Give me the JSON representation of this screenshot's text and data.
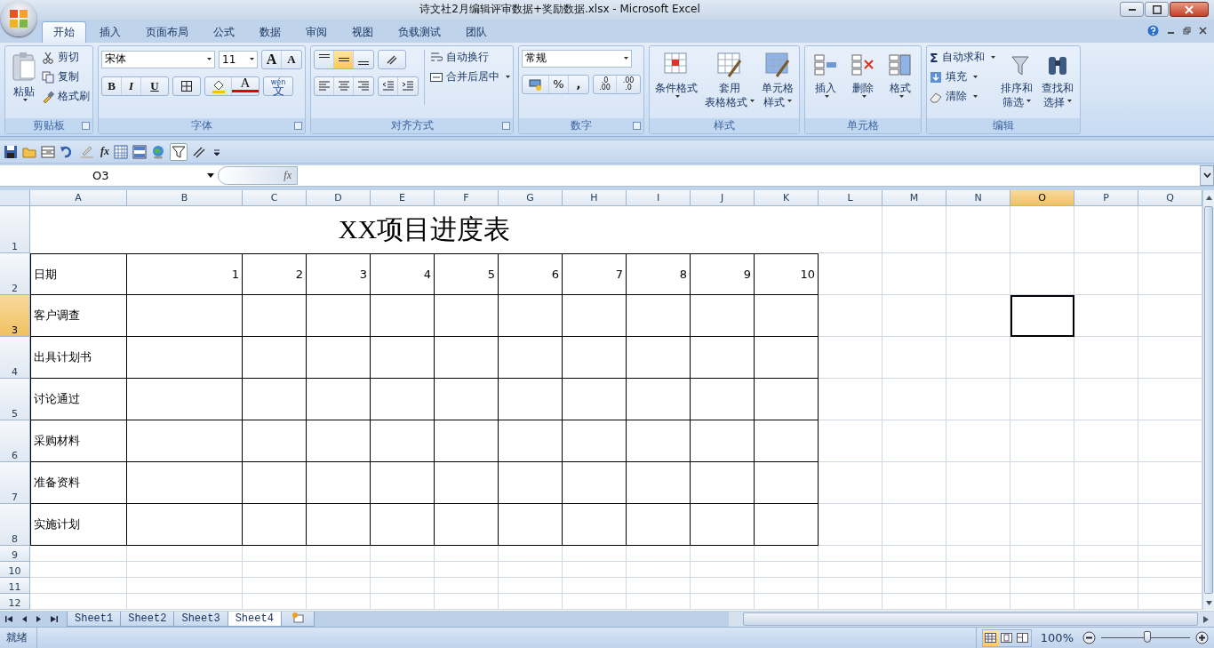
{
  "window": {
    "title": "诗文社2月编辑评审数据+奖励数据.xlsx - Microsoft Excel"
  },
  "ribbon_tabs": [
    {
      "label": "开始",
      "selected": true
    },
    {
      "label": "插入",
      "selected": false
    },
    {
      "label": "页面布局",
      "selected": false
    },
    {
      "label": "公式",
      "selected": false
    },
    {
      "label": "数据",
      "selected": false
    },
    {
      "label": "审阅",
      "selected": false
    },
    {
      "label": "视图",
      "selected": false
    },
    {
      "label": "负载测试",
      "selected": false
    },
    {
      "label": "团队",
      "selected": false
    }
  ],
  "ribbon": {
    "clipboard": {
      "title": "剪贴板",
      "paste": "粘贴",
      "cut": "剪切",
      "copy": "复制",
      "format_painter": "格式刷"
    },
    "font": {
      "title": "字体",
      "font_name": "宋体",
      "font_size": "11",
      "grow_font": "A",
      "shrink_font": "A",
      "bold": "B",
      "italic": "I",
      "underline": "U",
      "font_color": "A",
      "phonetic_top": "wén",
      "phonetic_char": "文"
    },
    "alignment": {
      "title": "对齐方式",
      "vertical": [
        {
          "selected": false
        },
        {
          "selected": true
        },
        {
          "selected": false
        }
      ],
      "wrap_text": "自动换行",
      "merge_center": "合并后居中"
    },
    "number": {
      "title": "数字",
      "format": "常规",
      "percent": "%",
      "comma": ",",
      "decimal_increase": [
        ".0",
        ".00"
      ],
      "decimal_decrease": [
        ".00",
        ".0"
      ]
    },
    "styles": {
      "title": "样式",
      "buttons": [
        {
          "lines": [
            "条件格式"
          ]
        },
        {
          "lines": [
            "套用",
            "表格格式"
          ]
        },
        {
          "lines": [
            "单元格",
            "样式"
          ]
        }
      ]
    },
    "cells": {
      "title": "单元格",
      "buttons": [
        {
          "lines": [
            "插入"
          ]
        },
        {
          "lines": [
            "删除"
          ]
        },
        {
          "lines": [
            "格式"
          ]
        }
      ]
    },
    "editing": {
      "title": "编辑",
      "sum_glyph": "Σ",
      "autosum": "自动求和",
      "fill": "填充",
      "clear": "清除",
      "buttons": [
        {
          "lines": [
            "排序和",
            "筛选"
          ]
        },
        {
          "lines": [
            "查找和",
            "选择"
          ]
        }
      ]
    }
  },
  "quick_access": {
    "function_glyph": "fx"
  },
  "formula_bar": {
    "name_box": "O3",
    "function_label": "fx"
  },
  "columns": [
    {
      "label": "A",
      "selected": false
    },
    {
      "label": "B",
      "selected": false
    },
    {
      "label": "C",
      "selected": false
    },
    {
      "label": "D",
      "selected": false
    },
    {
      "label": "E",
      "selected": false
    },
    {
      "label": "F",
      "selected": false
    },
    {
      "label": "G",
      "selected": false
    },
    {
      "label": "H",
      "selected": false
    },
    {
      "label": "I",
      "selected": false
    },
    {
      "label": "J",
      "selected": false
    },
    {
      "label": "K",
      "selected": false
    },
    {
      "label": "L",
      "selected": false
    },
    {
      "label": "M",
      "selected": false
    },
    {
      "label": "N",
      "selected": false
    },
    {
      "label": "O",
      "selected": true
    },
    {
      "label": "P",
      "selected": false
    },
    {
      "label": "Q",
      "selected": false
    }
  ],
  "rows": [
    {
      "label": "1",
      "selected": false,
      "kind": "title",
      "title": "XX项目进度表"
    },
    {
      "label": "2",
      "selected": false,
      "kind": "table",
      "cells": [
        "日期",
        "1",
        "2",
        "3",
        "4",
        "5",
        "6",
        "7",
        "8",
        "9",
        "10"
      ]
    },
    {
      "label": "3",
      "selected": true,
      "kind": "table",
      "cells": [
        "客户调查"
      ]
    },
    {
      "label": "4",
      "selected": false,
      "kind": "table",
      "cells": [
        "出具计划书"
      ]
    },
    {
      "label": "5",
      "selected": false,
      "kind": "table",
      "cells": [
        "讨论通过"
      ]
    },
    {
      "label": "6",
      "selected": false,
      "kind": "table",
      "cells": [
        "采购材料"
      ]
    },
    {
      "label": "7",
      "selected": false,
      "kind": "table",
      "cells": [
        "准备资料"
      ]
    },
    {
      "label": "8",
      "selected": false,
      "kind": "table",
      "cells": [
        "实施计划"
      ]
    },
    {
      "label": "9",
      "selected": false,
      "kind": "empty"
    },
    {
      "label": "10",
      "selected": false,
      "kind": "empty"
    },
    {
      "label": "11",
      "selected": false,
      "kind": "empty"
    },
    {
      "label": "12",
      "selected": false,
      "kind": "empty"
    }
  ],
  "sheet_tabs": [
    {
      "label": "Sheet1",
      "selected": false
    },
    {
      "label": "Sheet2",
      "selected": false
    },
    {
      "label": "Sheet3",
      "selected": false
    },
    {
      "label": "Sheet4",
      "selected": true
    }
  ],
  "status_bar": {
    "status": "就绪",
    "views": [
      {
        "selected": true
      },
      {
        "selected": false
      },
      {
        "selected": false
      }
    ],
    "zoom": "100%",
    "zoom_slider": {
      "level": 0.52
    }
  }
}
